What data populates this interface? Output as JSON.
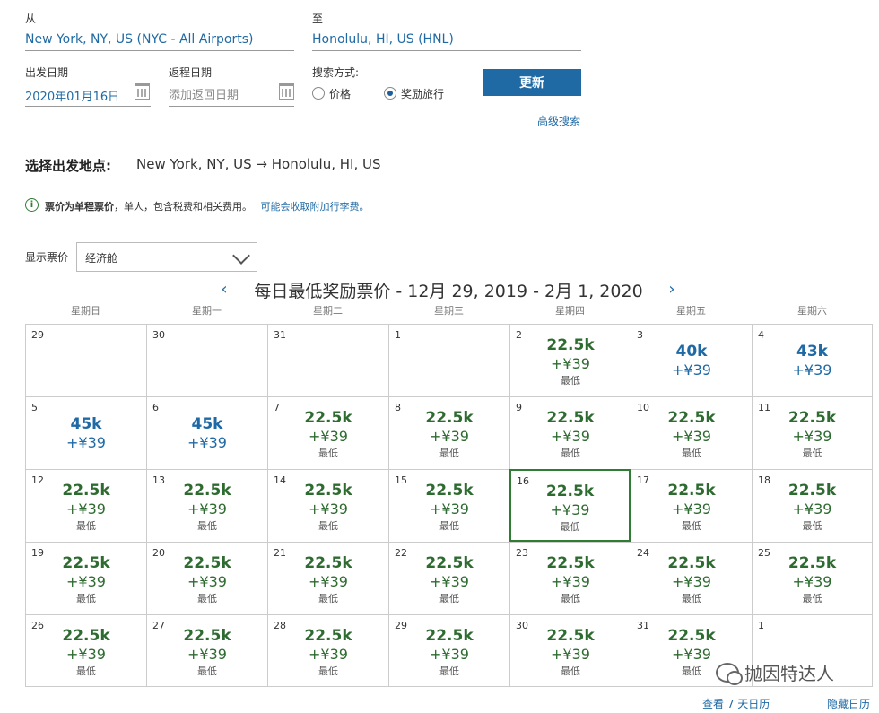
{
  "search": {
    "from_label": "从",
    "from_value": "New York, NY, US (NYC - All Airports)",
    "to_label": "至",
    "to_value": "Honolulu, HI, US (HNL)",
    "depart_label": "出发日期",
    "depart_value": "2020年01月16日",
    "return_label": "返程日期",
    "return_placeholder": "添加返回日期",
    "mode_label": "搜索方式:",
    "mode_price": "价格",
    "mode_award": "奖励旅行",
    "mode_selected": "award",
    "update_button": "更新",
    "advanced_link": "高级搜索"
  },
  "selection": {
    "title": "选择出发地点:",
    "route": "New York, NY, US → Honolulu, HI, US"
  },
  "notice": {
    "icon": "i",
    "bold": "票价为单程票价",
    "text": "，单人，包含税费和相关费用。",
    "link": "可能会收取附加行李费。"
  },
  "fare_display": {
    "label": "显示票价",
    "selected": "经济舱"
  },
  "calendar": {
    "title": "每日最低奖励票价 - 12月 29, 2019 - 2月 1, 2020",
    "weekdays": [
      "星期日",
      "星期一",
      "星期二",
      "星期三",
      "星期四",
      "星期五",
      "星期六"
    ],
    "low_label": "最低",
    "selected_day": "16",
    "weeks": [
      [
        {
          "day": "29",
          "points": "",
          "fee": "",
          "tone": ""
        },
        {
          "day": "30",
          "points": "",
          "fee": "",
          "tone": ""
        },
        {
          "day": "31",
          "points": "",
          "fee": "",
          "tone": ""
        },
        {
          "day": "1",
          "points": "",
          "fee": "",
          "tone": ""
        },
        {
          "day": "2",
          "points": "22.5k",
          "fee": "+¥39",
          "tone": "low"
        },
        {
          "day": "3",
          "points": "40k",
          "fee": "+¥39",
          "tone": "blue"
        },
        {
          "day": "4",
          "points": "43k",
          "fee": "+¥39",
          "tone": "blue"
        }
      ],
      [
        {
          "day": "5",
          "points": "45k",
          "fee": "+¥39",
          "tone": "blue"
        },
        {
          "day": "6",
          "points": "45k",
          "fee": "+¥39",
          "tone": "blue"
        },
        {
          "day": "7",
          "points": "22.5k",
          "fee": "+¥39",
          "tone": "low"
        },
        {
          "day": "8",
          "points": "22.5k",
          "fee": "+¥39",
          "tone": "low"
        },
        {
          "day": "9",
          "points": "22.5k",
          "fee": "+¥39",
          "tone": "low"
        },
        {
          "day": "10",
          "points": "22.5k",
          "fee": "+¥39",
          "tone": "low"
        },
        {
          "day": "11",
          "points": "22.5k",
          "fee": "+¥39",
          "tone": "low"
        }
      ],
      [
        {
          "day": "12",
          "points": "22.5k",
          "fee": "+¥39",
          "tone": "low"
        },
        {
          "day": "13",
          "points": "22.5k",
          "fee": "+¥39",
          "tone": "low"
        },
        {
          "day": "14",
          "points": "22.5k",
          "fee": "+¥39",
          "tone": "low"
        },
        {
          "day": "15",
          "points": "22.5k",
          "fee": "+¥39",
          "tone": "low"
        },
        {
          "day": "16",
          "points": "22.5k",
          "fee": "+¥39",
          "tone": "low"
        },
        {
          "day": "17",
          "points": "22.5k",
          "fee": "+¥39",
          "tone": "low"
        },
        {
          "day": "18",
          "points": "22.5k",
          "fee": "+¥39",
          "tone": "low"
        }
      ],
      [
        {
          "day": "19",
          "points": "22.5k",
          "fee": "+¥39",
          "tone": "low"
        },
        {
          "day": "20",
          "points": "22.5k",
          "fee": "+¥39",
          "tone": "low"
        },
        {
          "day": "21",
          "points": "22.5k",
          "fee": "+¥39",
          "tone": "low"
        },
        {
          "day": "22",
          "points": "22.5k",
          "fee": "+¥39",
          "tone": "low"
        },
        {
          "day": "23",
          "points": "22.5k",
          "fee": "+¥39",
          "tone": "low"
        },
        {
          "day": "24",
          "points": "22.5k",
          "fee": "+¥39",
          "tone": "low"
        },
        {
          "day": "25",
          "points": "22.5k",
          "fee": "+¥39",
          "tone": "low"
        }
      ],
      [
        {
          "day": "26",
          "points": "22.5k",
          "fee": "+¥39",
          "tone": "low"
        },
        {
          "day": "27",
          "points": "22.5k",
          "fee": "+¥39",
          "tone": "low"
        },
        {
          "day": "28",
          "points": "22.5k",
          "fee": "+¥39",
          "tone": "low"
        },
        {
          "day": "29",
          "points": "22.5k",
          "fee": "+¥39",
          "tone": "low"
        },
        {
          "day": "30",
          "points": "22.5k",
          "fee": "+¥39",
          "tone": "low"
        },
        {
          "day": "31",
          "points": "22.5k",
          "fee": "+¥39",
          "tone": "low"
        },
        {
          "day": "1",
          "points": "",
          "fee": "",
          "tone": ""
        }
      ]
    ],
    "view_7_days": "查看 7 天日历",
    "hide_calendar": "隐藏日历"
  },
  "watermark": "抛因特达人",
  "colors": {
    "link_blue": "#1f6aa5",
    "low_fare_green": "#2e6b30",
    "selected_border": "#2e7d32",
    "button_bg": "#1f6aa5"
  }
}
